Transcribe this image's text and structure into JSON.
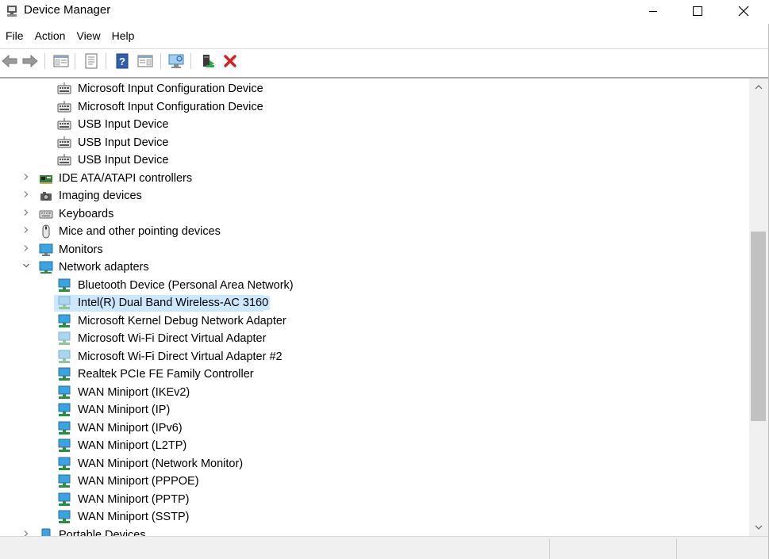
{
  "window": {
    "title": "Device Manager",
    "icon": "device-manager-icon"
  },
  "caption_buttons": {
    "minimize": "minimize-icon",
    "maximize": "maximize-icon",
    "close": "close-icon"
  },
  "menu": [
    "File",
    "Action",
    "View",
    "Help"
  ],
  "toolbar": [
    {
      "name": "back-button",
      "icon": "back-arrow-icon"
    },
    {
      "name": "forward-button",
      "icon": "forward-arrow-icon"
    },
    {
      "name": "show-hide-console-tree-button",
      "icon": "console-tree-icon"
    },
    {
      "name": "properties-button",
      "icon": "properties-icon"
    },
    {
      "name": "help-button",
      "icon": "help-icon"
    },
    {
      "name": "action-pane-button",
      "icon": "action-pane-icon"
    },
    {
      "name": "scan-hardware-button",
      "icon": "monitor-scan-icon"
    },
    {
      "name": "update-driver-button",
      "icon": "update-driver-icon"
    },
    {
      "name": "uninstall-device-button",
      "icon": "red-x-icon"
    }
  ],
  "tree": [
    {
      "label": "Microsoft Input Configuration Device",
      "level": 2,
      "icon": "hid-icon"
    },
    {
      "label": "Microsoft Input Configuration Device",
      "level": 2,
      "icon": "hid-icon"
    },
    {
      "label": "USB Input Device",
      "level": 2,
      "icon": "hid-icon"
    },
    {
      "label": "USB Input Device",
      "level": 2,
      "icon": "hid-icon"
    },
    {
      "label": "USB Input Device",
      "level": 2,
      "icon": "hid-icon"
    },
    {
      "label": "IDE ATA/ATAPI controllers",
      "level": 1,
      "icon": "ide-controller-icon",
      "expander": "collapsed"
    },
    {
      "label": "Imaging devices",
      "level": 1,
      "icon": "camera-icon",
      "expander": "collapsed"
    },
    {
      "label": "Keyboards",
      "level": 1,
      "icon": "keyboard-icon",
      "expander": "collapsed"
    },
    {
      "label": "Mice and other pointing devices",
      "level": 1,
      "icon": "mouse-icon",
      "expander": "collapsed"
    },
    {
      "label": "Monitors",
      "level": 1,
      "icon": "monitor-icon",
      "expander": "collapsed"
    },
    {
      "label": "Network adapters",
      "level": 1,
      "icon": "network-icon",
      "expander": "expanded"
    },
    {
      "label": "Bluetooth Device (Personal Area Network)",
      "level": 2,
      "icon": "network-adapter-icon"
    },
    {
      "label": "Intel(R) Dual Band Wireless-AC 3160",
      "level": 2,
      "icon": "network-adapter-disabled-icon",
      "selected": true
    },
    {
      "label": "Microsoft Kernel Debug Network Adapter",
      "level": 2,
      "icon": "network-adapter-icon"
    },
    {
      "label": "Microsoft Wi-Fi Direct Virtual Adapter",
      "level": 2,
      "icon": "network-adapter-disabled-icon"
    },
    {
      "label": "Microsoft Wi-Fi Direct Virtual Adapter #2",
      "level": 2,
      "icon": "network-adapter-disabled-icon"
    },
    {
      "label": "Realtek PCIe FE Family Controller",
      "level": 2,
      "icon": "network-adapter-icon"
    },
    {
      "label": "WAN Miniport (IKEv2)",
      "level": 2,
      "icon": "network-adapter-icon"
    },
    {
      "label": "WAN Miniport (IP)",
      "level": 2,
      "icon": "network-adapter-icon"
    },
    {
      "label": "WAN Miniport (IPv6)",
      "level": 2,
      "icon": "network-adapter-icon"
    },
    {
      "label": "WAN Miniport (L2TP)",
      "level": 2,
      "icon": "network-adapter-icon"
    },
    {
      "label": "WAN Miniport (Network Monitor)",
      "level": 2,
      "icon": "network-adapter-icon"
    },
    {
      "label": "WAN Miniport (PPPOE)",
      "level": 2,
      "icon": "network-adapter-icon"
    },
    {
      "label": "WAN Miniport (PPTP)",
      "level": 2,
      "icon": "network-adapter-icon"
    },
    {
      "label": "WAN Miniport (SSTP)",
      "level": 2,
      "icon": "network-adapter-icon"
    },
    {
      "label": "Portable Devices",
      "level": 1,
      "icon": "portable-device-icon",
      "expander": "collapsed"
    }
  ],
  "colors": {
    "selection": "#cce8ff",
    "scroll_thumb": "#c1c1c1",
    "status_bg": "#f0f0f0"
  }
}
